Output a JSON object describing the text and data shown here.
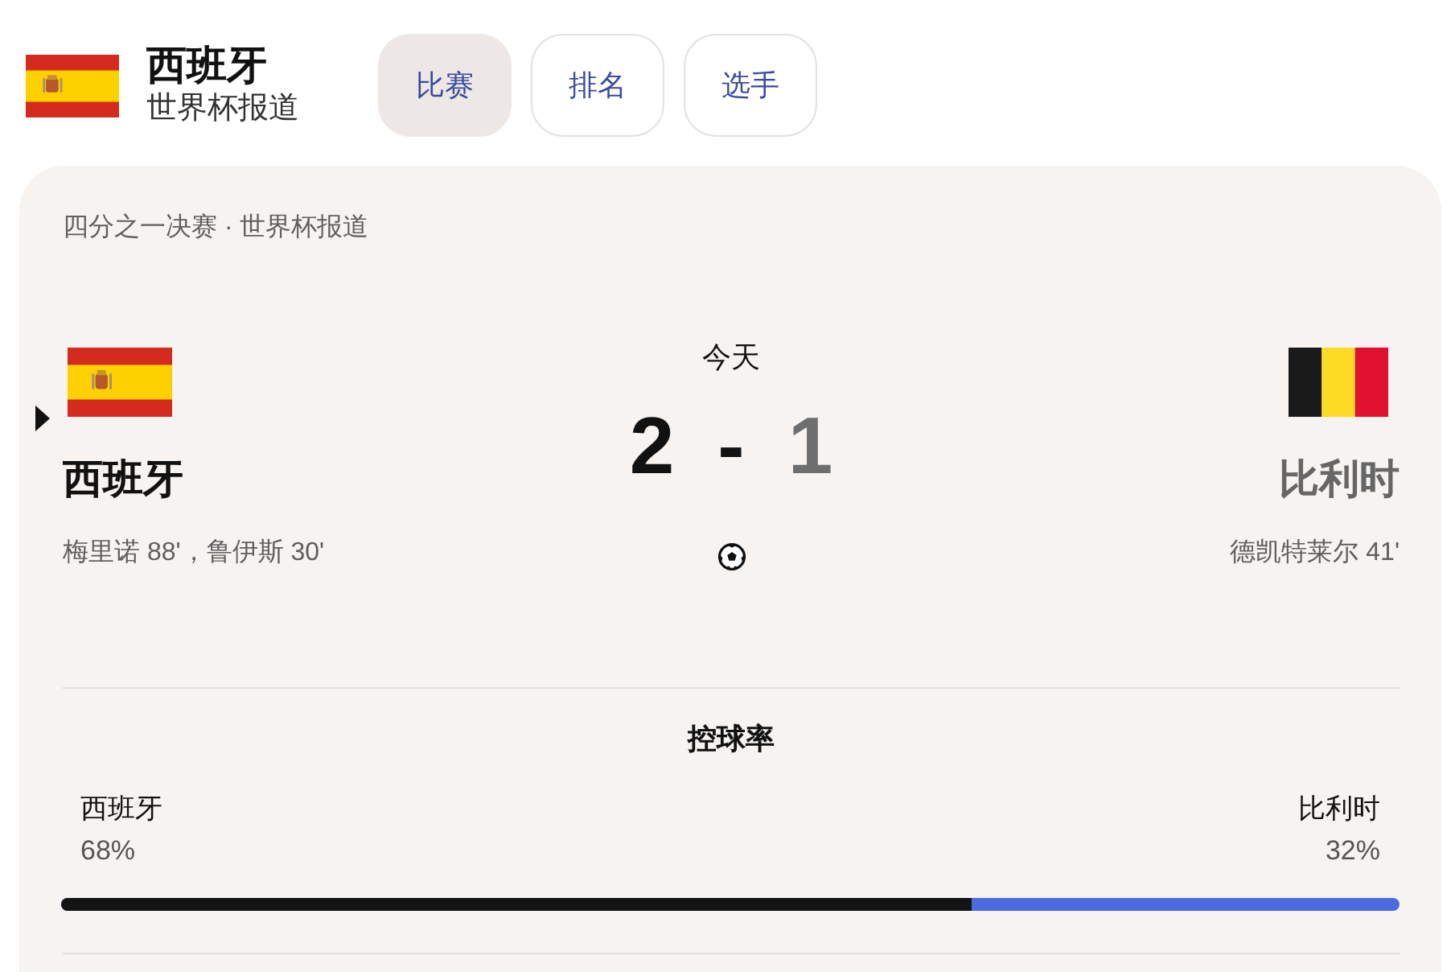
{
  "header": {
    "flag": {
      "kind": "spain"
    },
    "title": "西班牙",
    "subtitle": "世界杯报道"
  },
  "tabs": [
    {
      "label": "比赛",
      "selected": true
    },
    {
      "label": "排名",
      "selected": false
    },
    {
      "label": "选手",
      "selected": false
    }
  ],
  "match": {
    "stage": "四分之一决赛 · 世界杯报道",
    "date": "今天",
    "separator": "-",
    "teams": [
      {
        "flag": {
          "kind": "spain"
        },
        "name": "西班牙",
        "score": "2",
        "scorers": "梅里诺 88'，鲁伊斯 30'",
        "winner": true
      },
      {
        "flag": {
          "kind": "belgium"
        },
        "name": "比利时",
        "score": "1",
        "scorers": "德凯特莱尔 41'",
        "winner": false
      }
    ]
  },
  "possession": {
    "title": "控球率",
    "level": 0.68,
    "teams": [
      {
        "name": "西班牙",
        "value": "68%",
        "color": "#141414"
      },
      {
        "name": "比利时",
        "value": "32%",
        "color": "#4e6ae0"
      }
    ]
  }
}
